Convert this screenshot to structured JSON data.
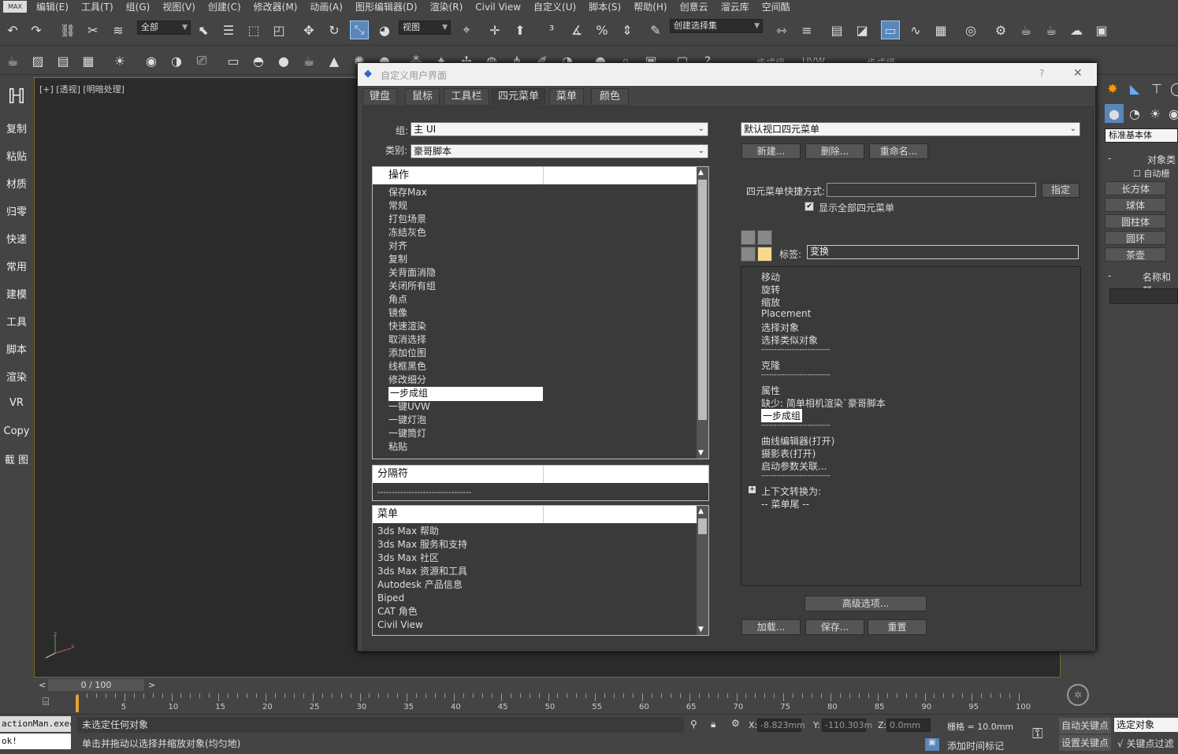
{
  "menubar": {
    "logo": "MAX",
    "items": [
      "编辑(E)",
      "工具(T)",
      "组(G)",
      "视图(V)",
      "创建(C)",
      "修改器(M)",
      "动画(A)",
      "图形编辑器(D)",
      "渲染(R)",
      "Civil View",
      "自定义(U)",
      "脚本(S)",
      "帮助(H)",
      "创意云",
      "溜云库",
      "空间酷"
    ]
  },
  "toolbar": {
    "selection_filter": "全部",
    "ref_coord": "视图",
    "named_selection": "创建选择集",
    "tabs_partial": [
      "一步成组",
      "UVW",
      "一步成组"
    ]
  },
  "leftbar": {
    "items": [
      "复制",
      "粘贴",
      "材质",
      "归零",
      "快速",
      "常用",
      "建模",
      "工具",
      "脚本",
      "渲染",
      "VR",
      "Copy",
      "截 图"
    ]
  },
  "viewport": {
    "label": "[+] [透视] [明暗处理]"
  },
  "dialog": {
    "title": "自定义用户界面",
    "help": "?",
    "close": "✕",
    "tabs": [
      "键盘",
      "鼠标",
      "工具栏",
      "四元菜单",
      "菜单",
      "颜色"
    ],
    "group_label": "组:",
    "group_value": "主 UI",
    "category_label": "类别:",
    "category_value": "豪哥脚本",
    "actions_header": "操作",
    "actions": [
      "保存Max",
      "常规",
      "打包场景",
      "冻结灰色",
      "对齐",
      "复制",
      "关背面消隐",
      "关闭所有组",
      "角点",
      "镜像",
      "快速渲染",
      "取消选择",
      "添加位图",
      "线框黑色",
      "修改细分",
      "一步成组",
      "一键UVW",
      "一键灯泡",
      "一键筒灯",
      "粘贴"
    ],
    "actions_selected": "一步成组",
    "separator_header": "分隔符",
    "separator_item": "---------------------------------",
    "menus_header": "菜单",
    "menus": [
      "3ds Max 帮助",
      "3ds Max 服务和支持",
      "3ds Max 社区",
      "3ds Max 资源和工具",
      "Autodesk 产品信息",
      "Biped",
      "CAT 角色",
      "Civil View"
    ],
    "quad_select": "默认视口四元菜单",
    "new_btn": "新建...",
    "delete_btn": "删除...",
    "rename_btn": "重命名...",
    "shortcut_label": "四元菜单快捷方式:",
    "shortcut_value": "",
    "assign_btn": "指定",
    "show_all_label": "显示全部四元菜单",
    "show_all_checked": "✔",
    "tag_label": "标签:",
    "tag_value": "变换",
    "quad_items": [
      "移动",
      "旋转",
      "缩放",
      "Placement",
      "选择对象",
      "选择类似对象",
      "---------------------------",
      "克隆",
      "---------------------------",
      "属性",
      "缺少: 简单相机渲染`豪哥脚本",
      "一步成组",
      "---------------------------",
      "曲线编辑器(打开)",
      "摄影表(打开)",
      "启动参数关联...",
      "---------------------------",
      "上下文转换为:",
      "-- 菜单尾 --"
    ],
    "expand_symbol": "+",
    "advanced_btn": "高级选项...",
    "load_btn": "加载...",
    "save_btn": "保存...",
    "reset_btn": "重置"
  },
  "cmdpanel": {
    "dropdown": "标准基本体",
    "rollout1": "对象类",
    "autogrid": "自动栅",
    "buttons": [
      "长方体",
      "球体",
      "圆柱体",
      "圆环",
      "茶壶"
    ],
    "rollout2": "名称和颜"
  },
  "timeline": {
    "frame": "0 / 100",
    "ticks": [
      "5",
      "10",
      "15",
      "20",
      "25",
      "30",
      "35",
      "40",
      "45",
      "50",
      "55",
      "60",
      "65",
      "70",
      "75",
      "80",
      "85",
      "90",
      "95",
      "100"
    ]
  },
  "status": {
    "script_line": "actionMan.exec",
    "ok": "ok!",
    "selection": "未选定任何对象",
    "prompt": "单击并拖动以选择并缩放对象(均匀地)",
    "x_label": "X:",
    "x_value": "-8.823mm",
    "y_label": "Y:",
    "y_value": "-110.303m",
    "z_label": "Z:",
    "z_value": "0.0mm",
    "grid": "栅格 = 10.0mm",
    "autokey": "自动关键点",
    "setkey": "设置关键点",
    "selected_obj": "选定对象",
    "keyfilter": "关键点过滤",
    "add_time_tag": "添加时间标记"
  }
}
